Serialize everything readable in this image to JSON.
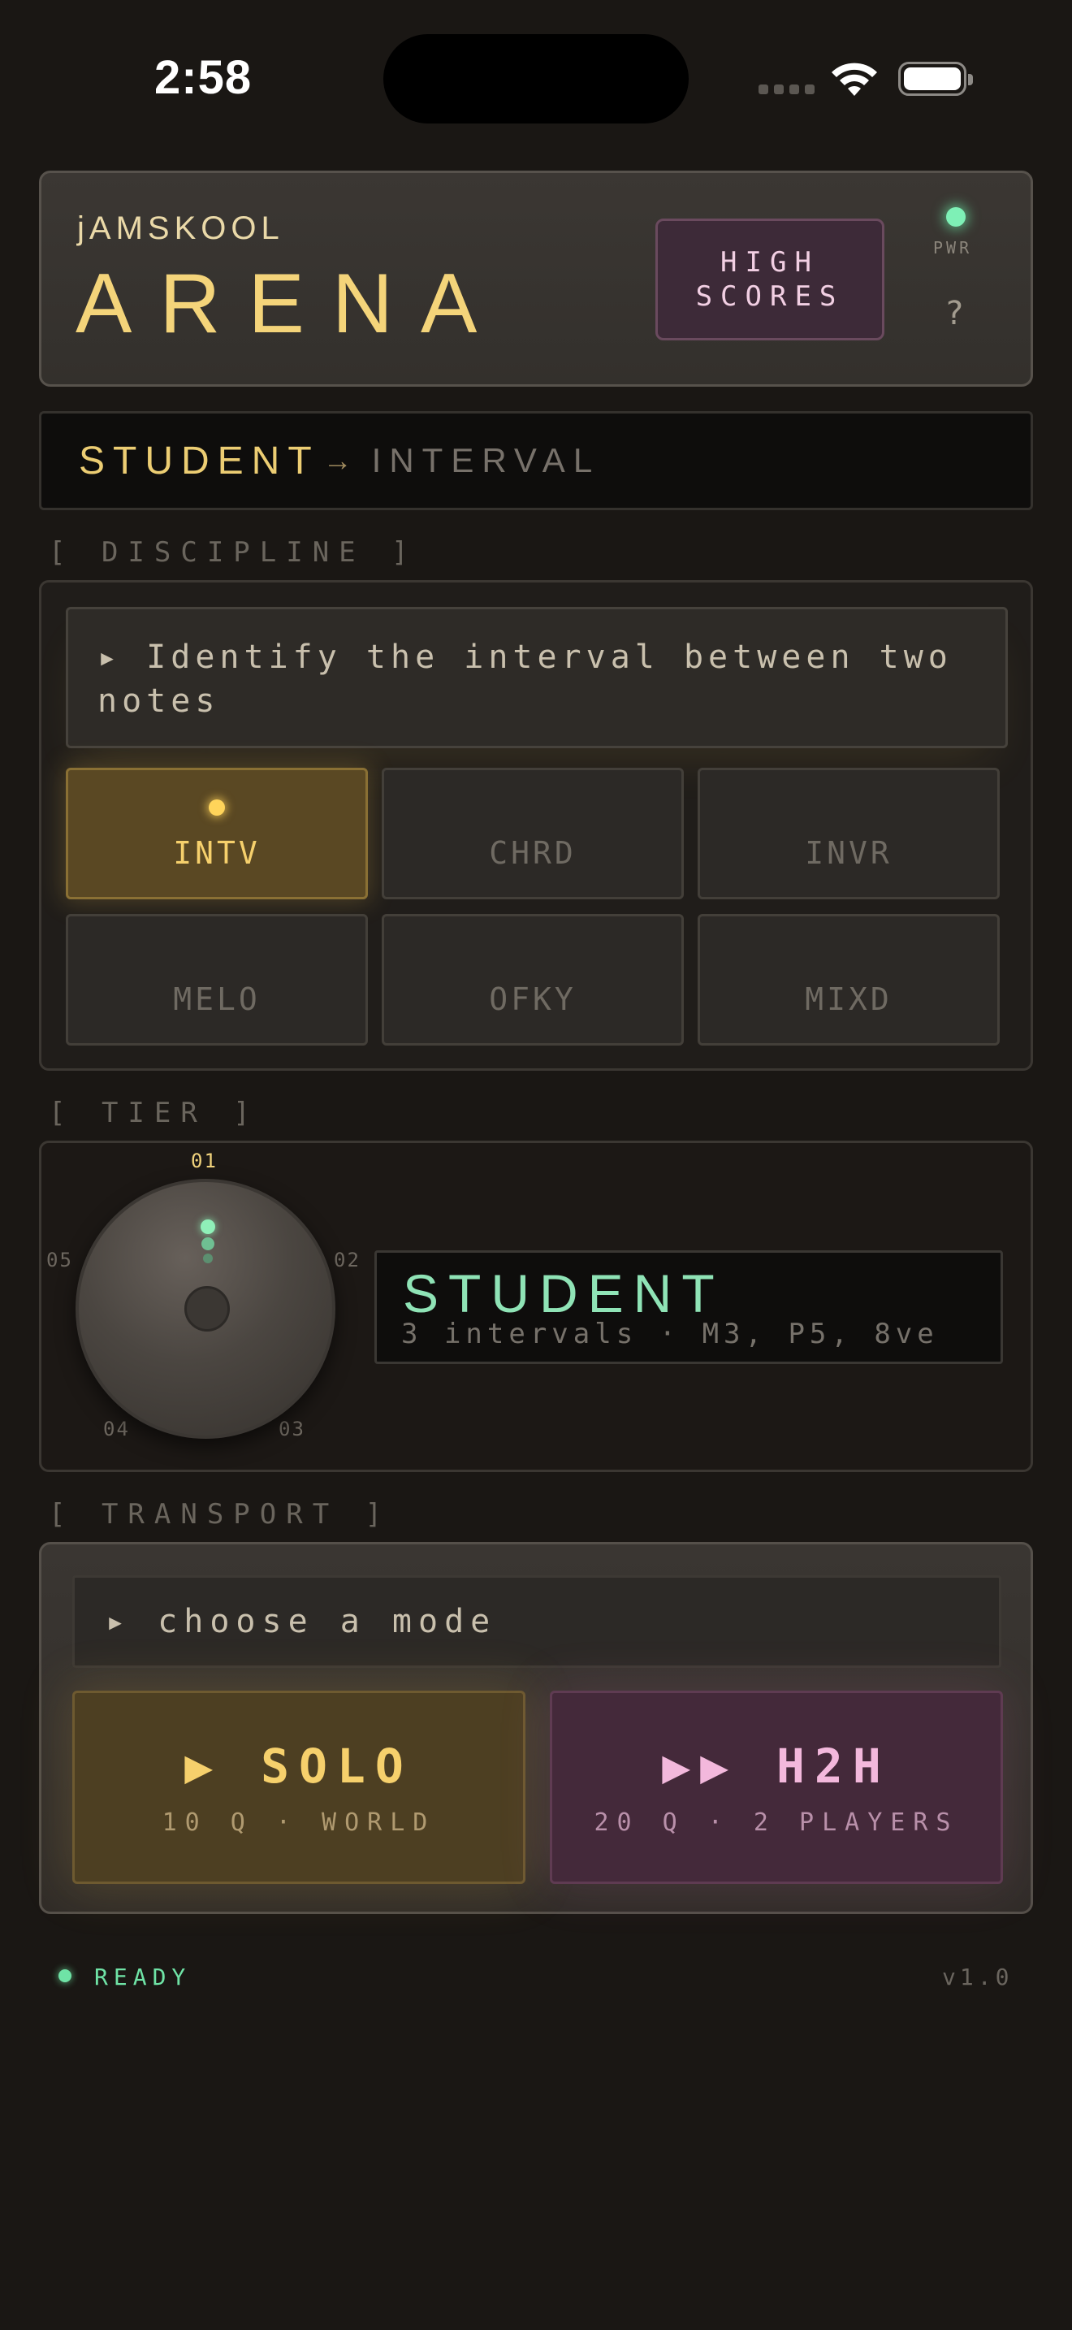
{
  "status_bar": {
    "time": "2:58"
  },
  "header": {
    "brand": "jAMSKOOL",
    "title": "ARENA",
    "high_scores_line1": "HIGH",
    "high_scores_line2": "SCORES",
    "power_label": "PWR",
    "help_label": "?",
    "power_color": "#7ef0b6"
  },
  "breadcrumb": {
    "tier": "STUDENT",
    "arrow": "→",
    "discipline": "INTERVAL"
  },
  "discipline": {
    "section_label": "[ DISCIPLINE ]",
    "description": "▸ Identify the interval between two notes",
    "selected": "INTV",
    "buttons": [
      "INTV",
      "CHRD",
      "INVR",
      "MELO",
      "OFKY",
      "MIXD"
    ]
  },
  "tier": {
    "section_label": "[ TIER ]",
    "ticks": [
      "01",
      "02",
      "03",
      "04",
      "05"
    ],
    "selected_tick": "01",
    "name": "STUDENT",
    "detail": "3 intervals · M3, P5, 8ve"
  },
  "transport": {
    "section_label": "[ TRANSPORT ]",
    "prompt": "▸ choose a mode",
    "solo_title": "▶ SOLO",
    "solo_sub": "10 Q · WORLD",
    "h2h_title": "▶▶ H2H",
    "h2h_sub": "20 Q · 2 PLAYERS"
  },
  "footer": {
    "status": "READY",
    "version": "v1.0"
  },
  "colors": {
    "accent_gold": "#f4d47a",
    "accent_green": "#8fe3b6",
    "accent_pink": "#f3b8dc",
    "background": "#1a1714"
  }
}
